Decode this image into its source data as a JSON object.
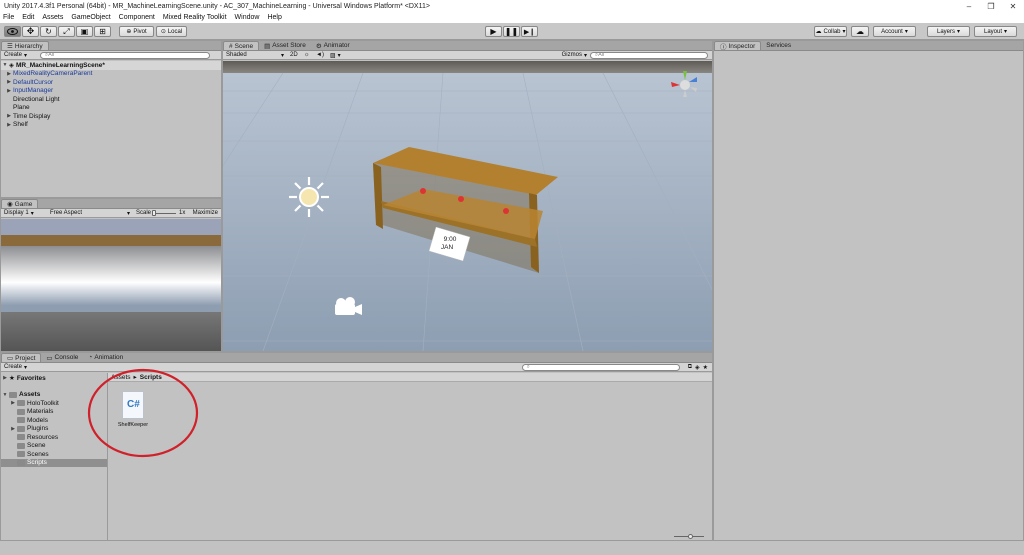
{
  "window": {
    "title": "Unity 2017.4.3f1 Personal (64bit) - MR_MachineLearningScene.unity - AC_307_MachineLearning - Universal Windows Platform* <DX11>",
    "controls": [
      "–",
      "❐",
      "✕"
    ]
  },
  "menu": [
    "File",
    "Edit",
    "Assets",
    "GameObject",
    "Component",
    "Mixed Reality Toolkit",
    "Window",
    "Help"
  ],
  "toolbar": {
    "pivot": "Pivot",
    "local": "Local",
    "collab": "Collab",
    "account": "Account",
    "layers": "Layers",
    "layout": "Layout"
  },
  "hierarchy": {
    "tab": "Hierarchy",
    "create": "Create",
    "search_placeholder": "All",
    "scene": "MR_MachineLearningScene*",
    "items": [
      {
        "label": "MixedRealityCameraParent",
        "blue": true,
        "arrow": true
      },
      {
        "label": "DefaultCursor",
        "blue": true,
        "arrow": true
      },
      {
        "label": "InputManager",
        "blue": true,
        "arrow": true
      },
      {
        "label": "Directional Light",
        "blue": false,
        "arrow": false
      },
      {
        "label": "Plane",
        "blue": false,
        "arrow": false
      },
      {
        "label": "Time Display",
        "blue": false,
        "arrow": true
      },
      {
        "label": "Shelf",
        "blue": false,
        "arrow": true
      }
    ]
  },
  "game": {
    "tab": "Game",
    "display": "Display 1",
    "aspect": "Free Aspect",
    "scale_label": "Scale",
    "scale_value": "1x",
    "maximize": "Maximize"
  },
  "scene_view": {
    "tabs": [
      "Scene",
      "Asset Store",
      "Animator"
    ],
    "shaded": "Shaded",
    "mode_2d": "2D",
    "gizmos": "Gizmos",
    "search_placeholder": "All",
    "display_time": "9:00",
    "display_month": "JAN"
  },
  "inspector": {
    "tabs": [
      "Inspector",
      "Services"
    ]
  },
  "project": {
    "tabs": [
      "Project",
      "Console",
      "Animation"
    ],
    "create": "Create",
    "favorites": "Favorites",
    "assets": "Assets",
    "folders": [
      {
        "label": "HoloToolkit",
        "arrow": true
      },
      {
        "label": "Materials",
        "arrow": false
      },
      {
        "label": "Models",
        "arrow": false
      },
      {
        "label": "Plugins",
        "arrow": true
      },
      {
        "label": "Resources",
        "arrow": false
      },
      {
        "label": "Scene",
        "arrow": false
      },
      {
        "label": "Scenes",
        "arrow": false
      },
      {
        "label": "Scripts",
        "arrow": false,
        "selected": true
      }
    ],
    "breadcrumb_root": "Assets",
    "breadcrumb_sep": "▸",
    "breadcrumb_current": "Scripts",
    "file": {
      "name": "ShelfKeeper",
      "icon_text": "C#"
    }
  }
}
